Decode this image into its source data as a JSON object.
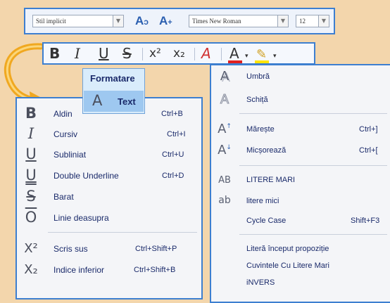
{
  "font_toolbar": {
    "style_value": "Stil implicit",
    "font_value": "Times New Roman",
    "size_value": "12"
  },
  "format_toolbar": {
    "bold": "B",
    "italic": "I",
    "underline": "U",
    "strike": "S",
    "superscript": "x²",
    "subscript": "x₂",
    "clear": "A",
    "font_color": "A"
  },
  "formatare": {
    "title": "Formatare",
    "item_icon": "A",
    "item_label": "Text"
  },
  "left_menu": {
    "items": [
      {
        "icon": "B",
        "label": "Aldin",
        "shortcut": "Ctrl+B"
      },
      {
        "icon": "I",
        "label": "Cursiv",
        "shortcut": "Ctrl+I"
      },
      {
        "icon": "U",
        "label": "Subliniat",
        "shortcut": "Ctrl+U"
      },
      {
        "icon": "U",
        "label": "Double Underline",
        "shortcut": "Ctrl+D"
      },
      {
        "icon": "S",
        "label": "Barat",
        "shortcut": ""
      },
      {
        "icon": "O",
        "label": "Linie deasupra",
        "shortcut": ""
      },
      {
        "icon": "X²",
        "label": "Scris sus",
        "shortcut": "Ctrl+Shift+P"
      },
      {
        "icon": "X₂",
        "label": "Indice inferior",
        "shortcut": "Ctrl+Shift+B"
      }
    ]
  },
  "right_menu": {
    "items": [
      {
        "icon": "A",
        "label": "Umbră",
        "shortcut": ""
      },
      {
        "icon": "A",
        "label": "Schiță",
        "shortcut": ""
      },
      {
        "icon": "A",
        "label": "Mărește",
        "shortcut": "Ctrl+]"
      },
      {
        "icon": "A",
        "label": "Micșorează",
        "shortcut": "Ctrl+["
      },
      {
        "icon": "AB",
        "label": "LITERE MARI",
        "shortcut": ""
      },
      {
        "icon": "ab",
        "label": "litere mici",
        "shortcut": ""
      },
      {
        "icon": "",
        "label": "Cycle Case",
        "shortcut": "Shift+F3"
      },
      {
        "icon": "",
        "label": "Literă început propoziție",
        "shortcut": ""
      },
      {
        "icon": "",
        "label": "Cuvintele Cu Litere Mari",
        "shortcut": ""
      },
      {
        "icon": "",
        "label": "iNVERS",
        "shortcut": ""
      }
    ]
  },
  "colors": {
    "accent_border": "#3d7fd0",
    "arrow": "#f0a820",
    "background": "#f3d6ac"
  }
}
